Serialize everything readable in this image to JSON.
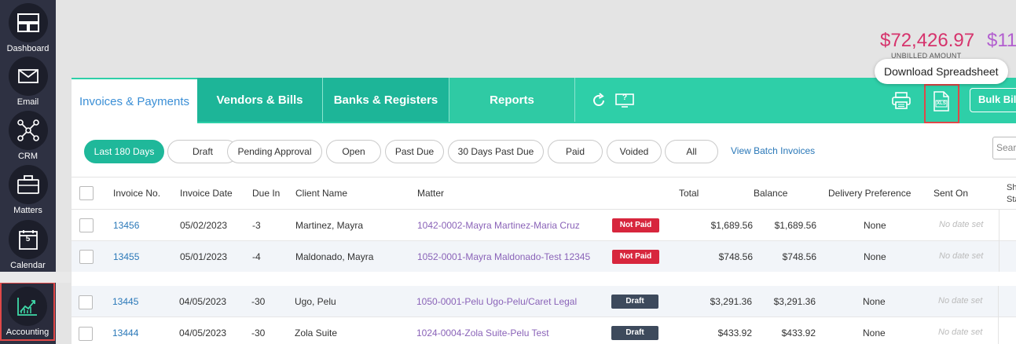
{
  "sidebar": {
    "items": [
      {
        "label": "Dashboard",
        "icon": "dashboard-icon"
      },
      {
        "label": "Email",
        "icon": "envelope-icon"
      },
      {
        "label": "CRM",
        "icon": "network-icon"
      },
      {
        "label": "Matters",
        "icon": "briefcase-icon"
      },
      {
        "label": "Calendar",
        "icon": "calendar-icon",
        "calendar_day": "5"
      },
      {
        "label": "Accounting",
        "icon": "chart-trend-icon",
        "active": true
      }
    ]
  },
  "totals": {
    "unbilled_amount": "$72,426.97",
    "unbilled_label": "UNBILLED AMOUNT",
    "second_amount": "$11"
  },
  "tooltip": {
    "text": "Download Spreadsheet"
  },
  "tabs": [
    {
      "label": "Invoices & Payments",
      "active": true
    },
    {
      "label": "Vendors & Bills"
    },
    {
      "label": "Banks & Registers"
    },
    {
      "label": "Reports"
    }
  ],
  "toolbar": {
    "help_glyph": "?",
    "xls_label": "XLS",
    "bulk_label": "Bulk Billing"
  },
  "filters": [
    {
      "label": "Last 180 Days",
      "active": true
    },
    {
      "label": "Draft"
    },
    {
      "label": "Pending Approval"
    },
    {
      "label": "Open"
    },
    {
      "label": "Past Due"
    },
    {
      "label": "30 Days Past Due"
    },
    {
      "label": "Paid"
    },
    {
      "label": "Voided"
    },
    {
      "label": "All"
    }
  ],
  "batch_link": "View Batch Invoices",
  "search": {
    "placeholder": "Search"
  },
  "table": {
    "headers": {
      "invoice_no": "Invoice No.",
      "invoice_date": "Invoice Date",
      "due_in": "Due In",
      "client_name": "Client Name",
      "matter": "Matter",
      "total": "Total",
      "balance": "Balance",
      "delivery": "Delivery Preference",
      "sent_on": "Sent On",
      "share_status_1": "Sha",
      "share_status_2": "Sta"
    },
    "rows": [
      {
        "invoice_no": "13456",
        "date": "05/02/2023",
        "due_in": "-3",
        "client": "Martinez, Mayra",
        "matter": "1042-0002-Mayra Martinez-Maria Cruz",
        "status": "Not Paid",
        "total": "$1,689.56",
        "balance": "$1,689.56",
        "delivery": "None",
        "sent_on": "No date set"
      },
      {
        "invoice_no": "13455",
        "date": "05/01/2023",
        "due_in": "-4",
        "client": "Maldonado, Mayra",
        "matter": "1052-0001-Mayra Maldonado-Test 12345",
        "status": "Not Paid",
        "total": "$748.56",
        "balance": "$748.56",
        "delivery": "None",
        "sent_on": "No date set"
      },
      {
        "invoice_no": "13445",
        "date": "04/05/2023",
        "due_in": "-30",
        "client": "Ugo, Pelu",
        "matter": "1050-0001-Pelu Ugo-Pelu/Caret Legal",
        "status": "Draft",
        "total": "$3,291.36",
        "balance": "$3,291.36",
        "delivery": "None",
        "sent_on": "No date set"
      },
      {
        "invoice_no": "13444",
        "date": "04/05/2023",
        "due_in": "-30",
        "client": "Zola Suite",
        "matter": "1024-0004-Zola Suite-Pelu Test",
        "status": "Draft",
        "total": "$433.92",
        "balance": "$433.92",
        "delivery": "None",
        "sent_on": "No date set"
      }
    ]
  },
  "colors": {
    "accent": "#2ecfa8",
    "sidebar": "#2e3142",
    "not_paid": "#d7263d",
    "draft": "#3d4a5c",
    "highlight": "#e04848"
  }
}
